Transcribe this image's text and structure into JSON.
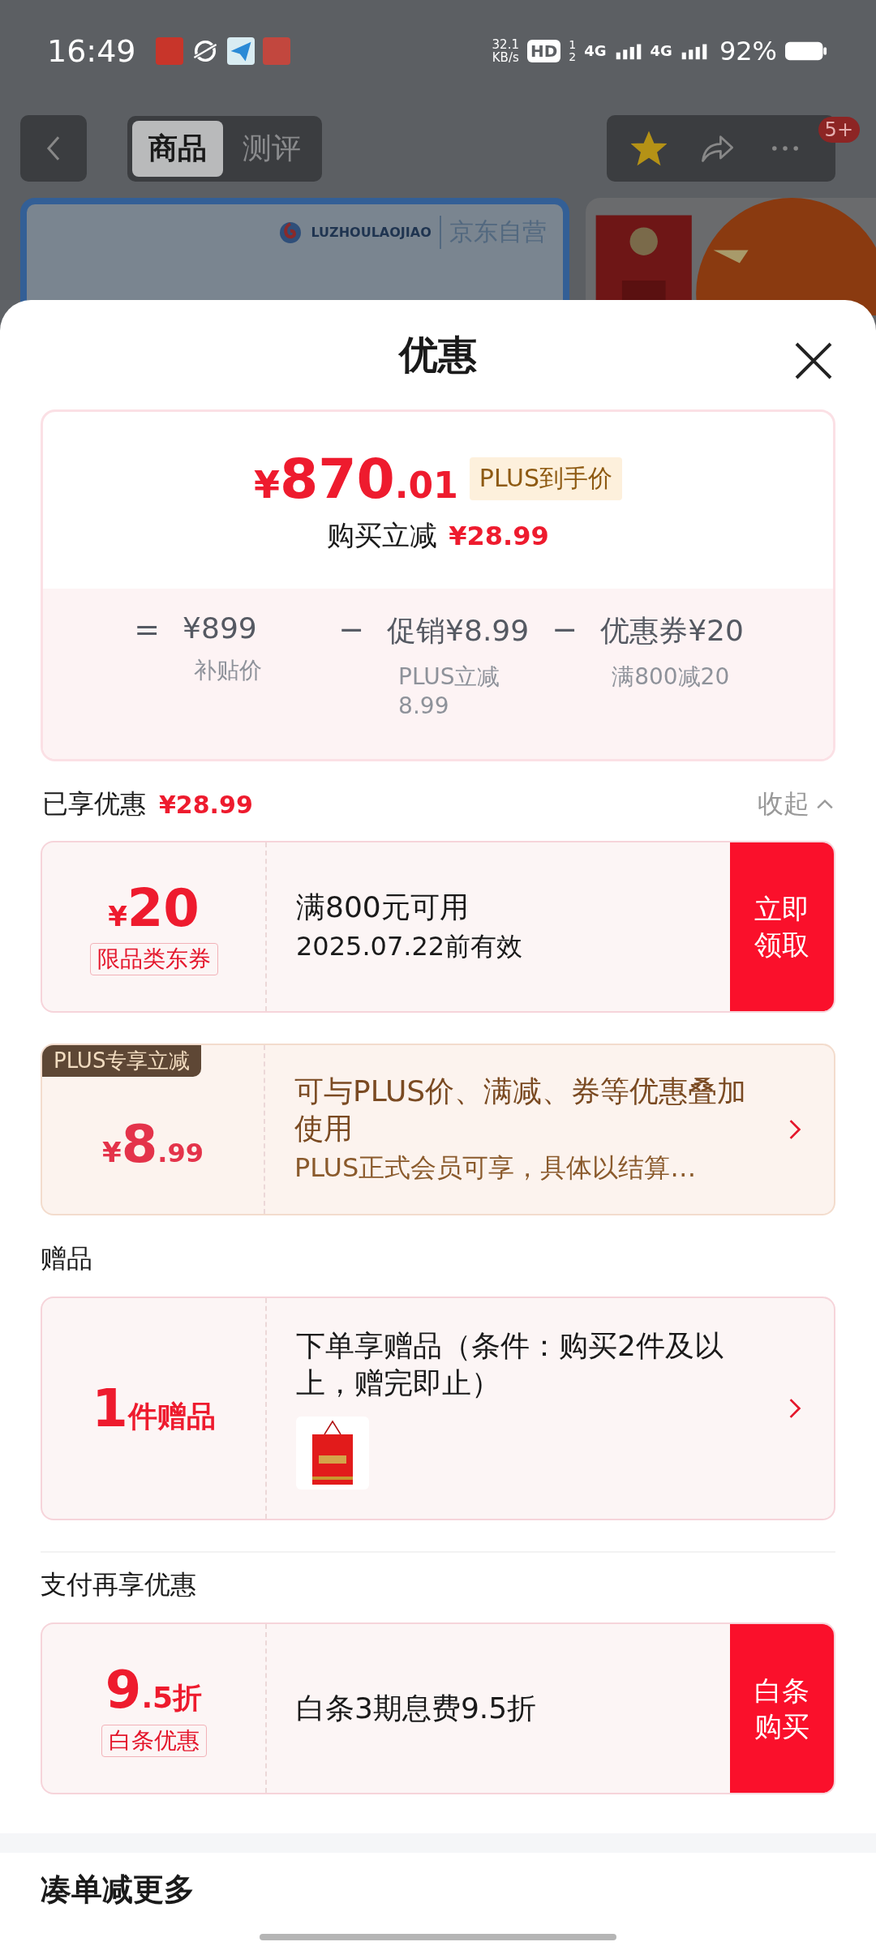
{
  "status_bar": {
    "time": "16:49",
    "net_speed": "32.1",
    "net_unit": "KB/s",
    "hd": "HD",
    "sim_1": "1",
    "sim_2": "2",
    "signal_1": "4G",
    "signal_2": "4G",
    "battery": "92%"
  },
  "nav": {
    "tabs": [
      {
        "label": "商品",
        "selected": true
      },
      {
        "label": "测评",
        "selected": false
      }
    ],
    "badge": "5+",
    "favorite": true
  },
  "product": {
    "brand_en": "LUZHOULAOJIAO",
    "store": "京东自营"
  },
  "sheet": {
    "title": "优惠",
    "summary": {
      "symbol": "¥",
      "integer": "870",
      "decimal": ".01",
      "tag": "PLUS到手价",
      "reduce_label": "购买立减",
      "reduce_amount": "¥28.99",
      "formula": [
        {
          "op": "=",
          "amount": "¥899",
          "note": "补贴价"
        },
        {
          "op": "−",
          "label": "促销",
          "amount": "¥8.99",
          "note": "PLUS立减8.99"
        },
        {
          "op": "−",
          "label": "优惠券",
          "amount": "¥20",
          "note": "满800减20"
        }
      ]
    },
    "enjoyed": {
      "label": "已享优惠",
      "amount": "¥28.99",
      "toggle": "收起",
      "expanded": true
    },
    "offers": [
      {
        "kind": "coupon",
        "symbol": "¥",
        "amount": "20",
        "tag": "限品类东券",
        "title": "满800元可用",
        "subtitle": "2025.07.22前有效",
        "action": "立即领取"
      },
      {
        "kind": "plus",
        "ribbon": "PLUS专享立减",
        "symbol": "¥",
        "amount": "8",
        "decimal": ".99",
        "title": "可与PLUS价、满减、券等优惠叠加使用",
        "subtitle": "PLUS正式会员可享，具体以结算…"
      }
    ],
    "gift_section": {
      "heading": "赠品",
      "offer": {
        "kind": "gift",
        "amount": "1",
        "unit": "件赠品",
        "title": "下单享赠品（条件：购买2件及以上，赠完即止）"
      }
    },
    "payment_section": {
      "heading": "支付再享优惠",
      "offer": {
        "kind": "pay",
        "amount": "9",
        "decimal": ".5折",
        "tag": "白条优惠",
        "title": "白条3期息费9.5折",
        "action": "白条购买"
      }
    },
    "more_heading": "凑单减更多"
  }
}
